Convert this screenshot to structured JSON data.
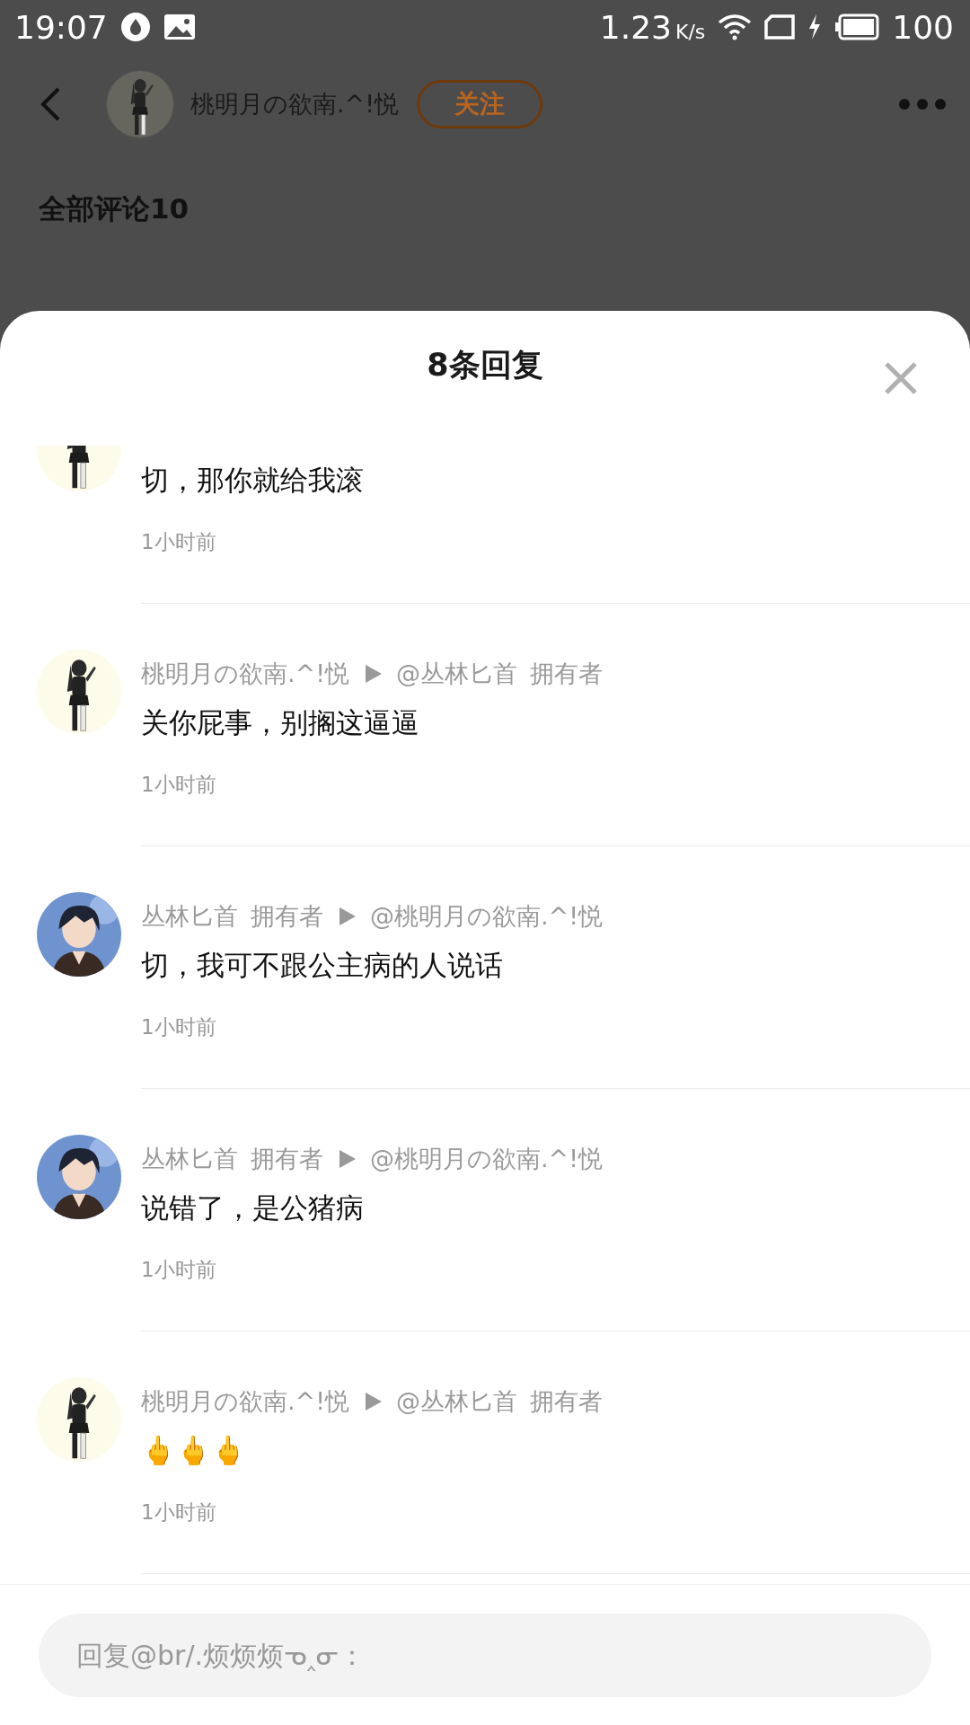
{
  "status_bar": {
    "time": "19:07",
    "speed": "1.23",
    "speed_unit": "K/s",
    "battery": "100"
  },
  "header": {
    "author": "桃明月の欲南.^!悦",
    "follow": "关注"
  },
  "comments_heading": "全部评论10",
  "sheet": {
    "title": "8条回复",
    "replies": [
      {
        "content": "切，那你就给我滚",
        "time": "1小时前",
        "avatar": {
          "kind": "girl"
        }
      },
      {
        "author": "桃明月の欲南.^!悦",
        "reply_to": "@丛林匕首",
        "reply_to_tag": "拥有者",
        "content": "关你屁事，别搁这逼逼",
        "time": "1小时前",
        "avatar": {
          "kind": "girl"
        }
      },
      {
        "author": "丛林匕首",
        "author_tag": "拥有者",
        "reply_to": "@桃明月の欲南.^!悦",
        "content": "切，我可不跟公主病的人说话",
        "time": "1小时前",
        "avatar": {
          "kind": "boy"
        }
      },
      {
        "author": "丛林匕首",
        "author_tag": "拥有者",
        "reply_to": "@桃明月の欲南.^!悦",
        "content": "说错了，是公猪病",
        "time": "1小时前",
        "avatar": {
          "kind": "boy"
        }
      },
      {
        "author": "桃明月の欲南.^!悦",
        "reply_to": "@丛林匕首",
        "reply_to_tag": "拥有者",
        "content": "🖕🖕🖕",
        "time": "1小时前",
        "avatar": {
          "kind": "girl"
        }
      }
    ],
    "reply_field": {
      "placeholder": "回复@br/.烦烦烦ᓀ‸ᓂ："
    }
  }
}
